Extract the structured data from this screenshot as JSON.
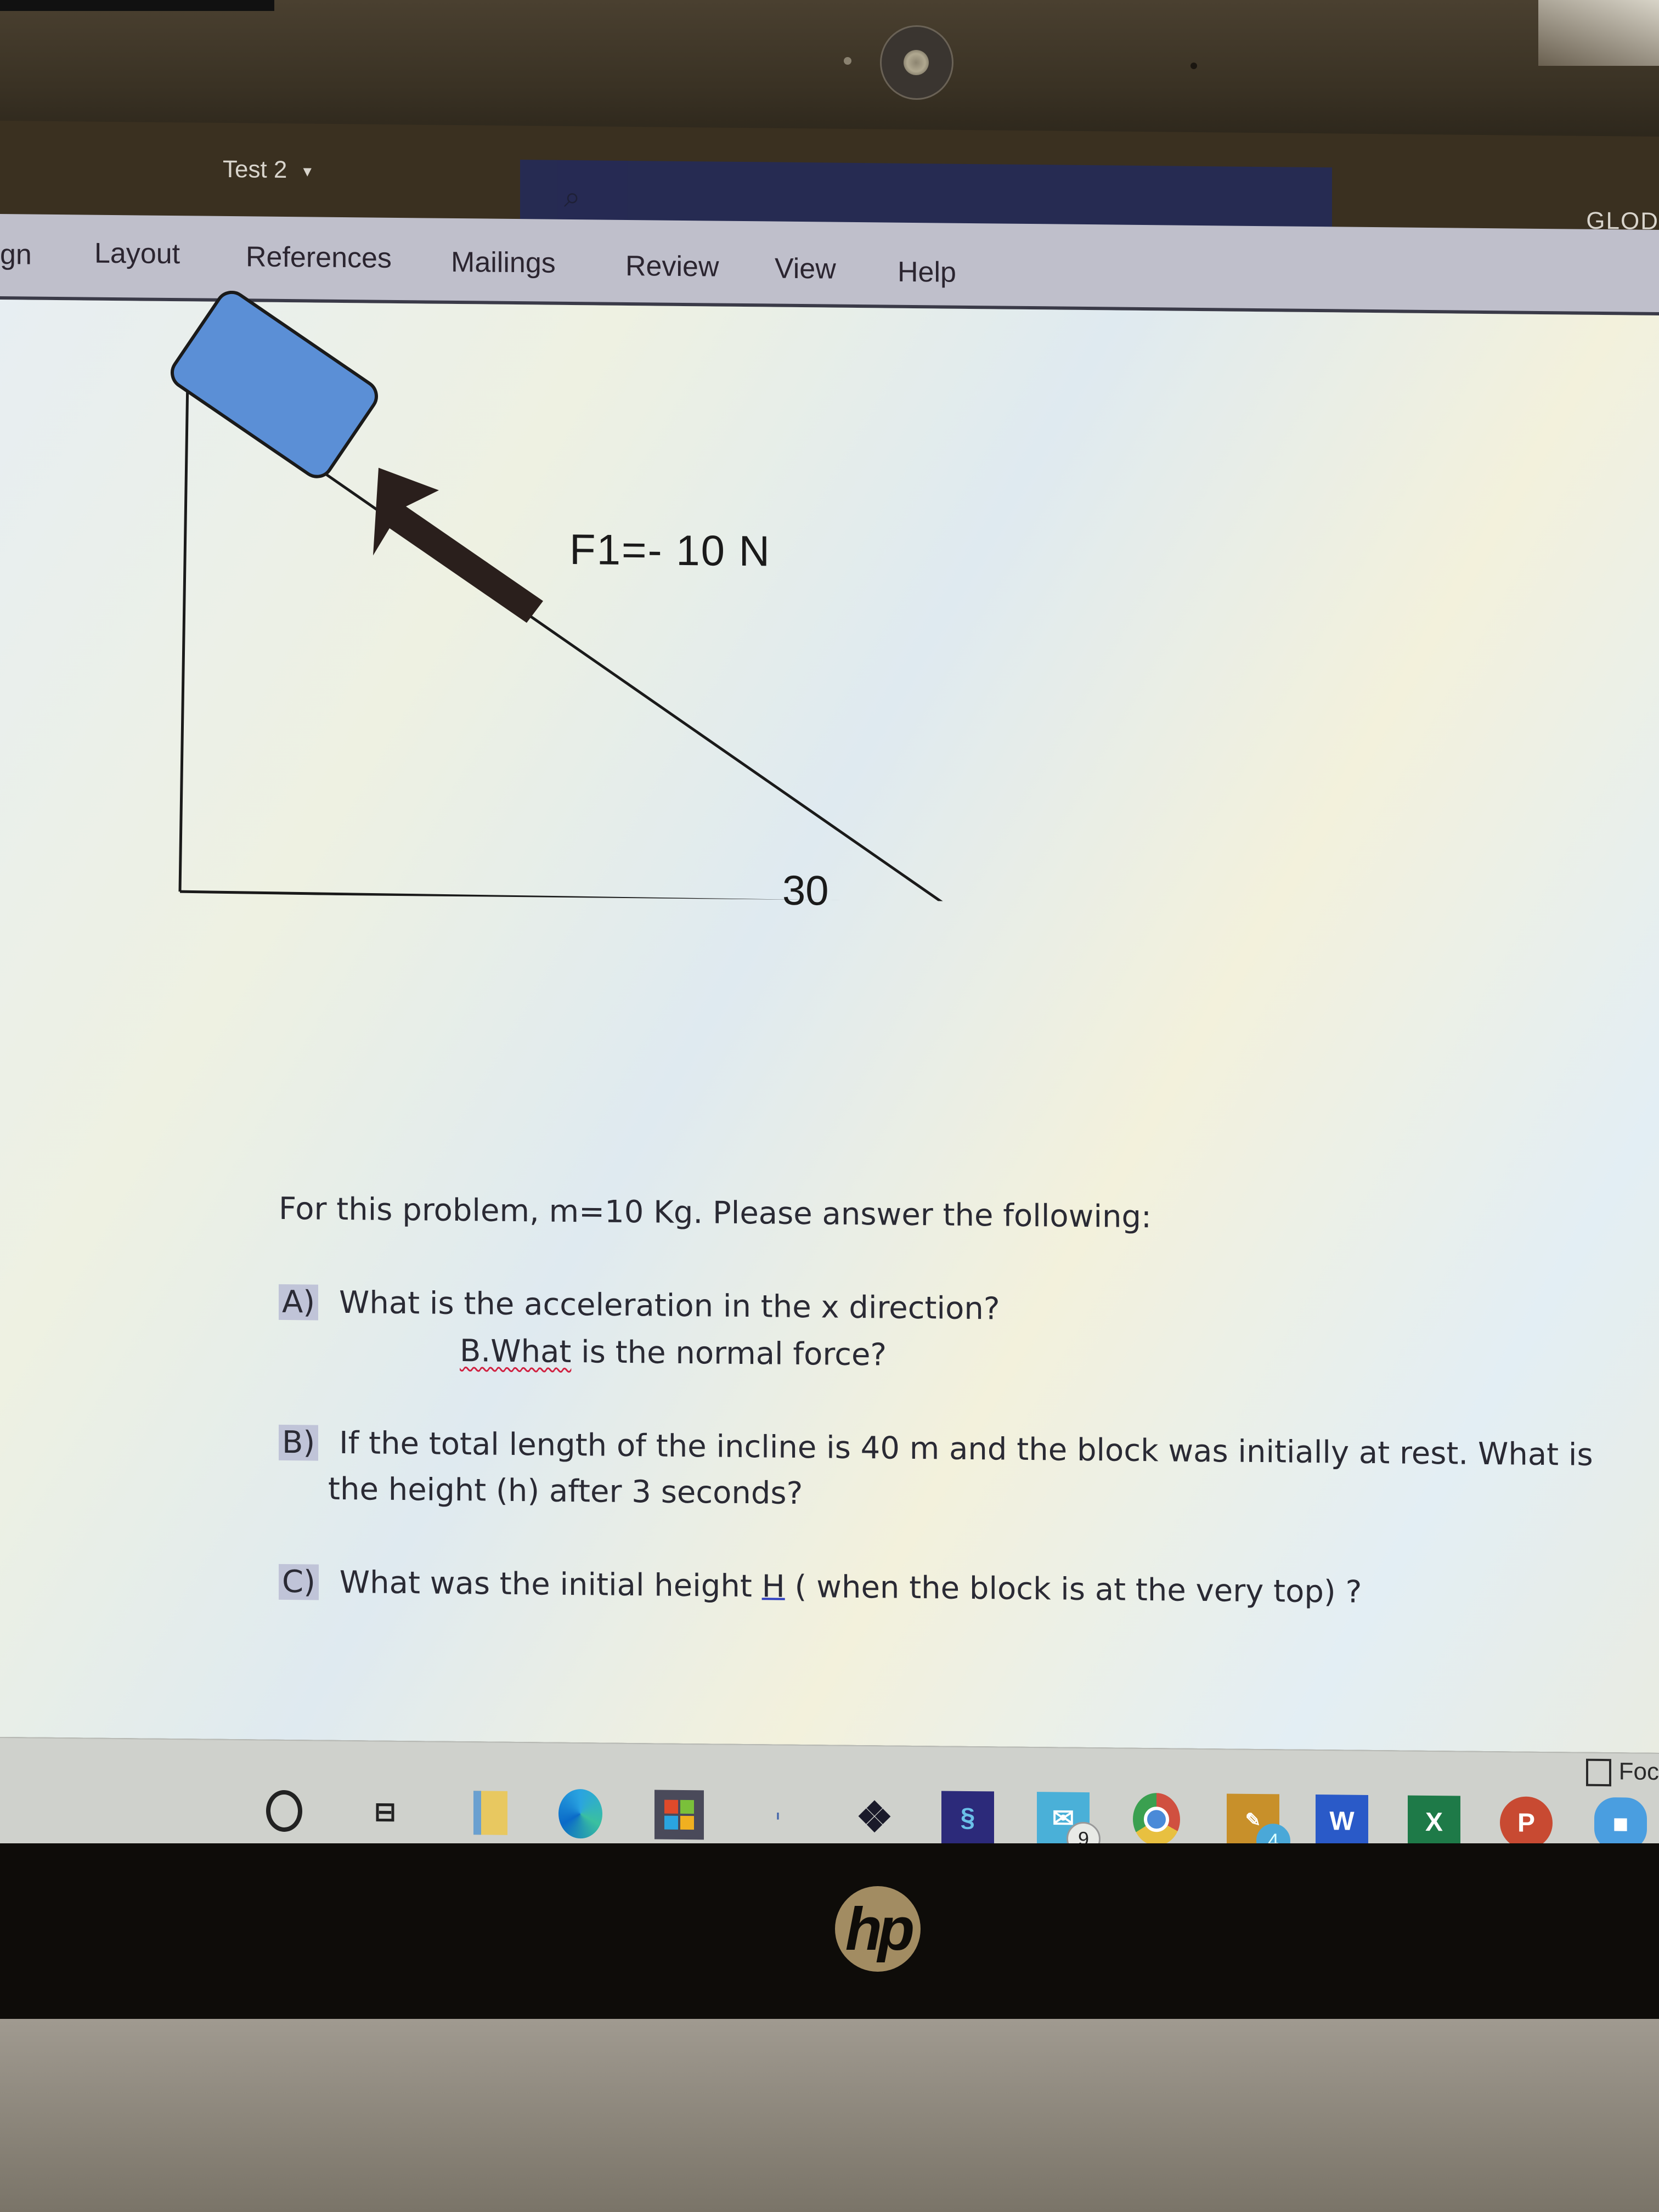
{
  "window": {
    "document_title": "Test 2",
    "user_name": "GLOD",
    "focus_label": "Foc"
  },
  "ribbon": {
    "tabs": [
      "gn",
      "Layout",
      "References",
      "Mailings",
      "Review",
      "View",
      "Help"
    ]
  },
  "diagram": {
    "force_label": "F1=- 10 N",
    "angle_label": "30",
    "block_color": "#5b8fd6",
    "arrow_color": "#2a1f1c"
  },
  "problem": {
    "intro": "For this problem, m=10 Kg. Please answer the following:",
    "a_marker": "A)",
    "a_text": "What is the acceleration in the x direction?",
    "a_sub_prefix": "B.What",
    "a_sub_rest": " is the normal force?",
    "b_marker": "B)",
    "b_line1": "If the total length of the incline is 40 m and the block was initially at rest.  What is",
    "b_line2": "the height (h) after 3 seconds?",
    "c_marker": "C)",
    "c_text_before": "What was the initial height ",
    "c_underlined": "H",
    "c_text_after": " ( when the block is  at the very top)   ?"
  },
  "taskbar": {
    "icons": [
      {
        "name": "cortana-search",
        "label": ""
      },
      {
        "name": "task-view",
        "label": ""
      },
      {
        "name": "file-explorer",
        "label": ""
      },
      {
        "name": "edge",
        "label": ""
      },
      {
        "name": "microsoft-store",
        "label": ""
      },
      {
        "name": "dropbox",
        "label": ""
      },
      {
        "name": "app-s",
        "label": ""
      },
      {
        "name": "mail",
        "label": "",
        "badge": "9"
      },
      {
        "name": "chrome",
        "label": ""
      },
      {
        "name": "sticky-app",
        "label": "",
        "badge": "4"
      },
      {
        "name": "word",
        "label": "W"
      },
      {
        "name": "excel",
        "label": "X"
      },
      {
        "name": "powerpoint",
        "label": "P"
      },
      {
        "name": "zoom",
        "label": ""
      }
    ]
  },
  "bezel": {
    "logo": "hp"
  }
}
